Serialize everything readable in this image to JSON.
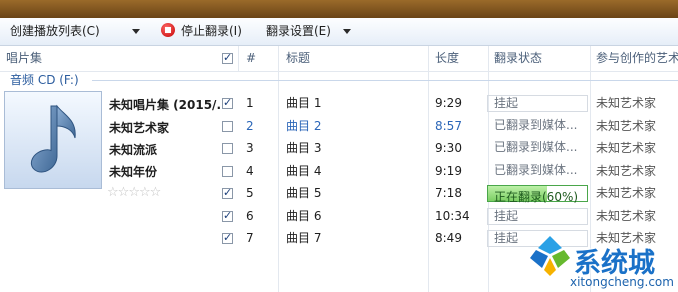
{
  "toolbar": {
    "create_playlist": "创建播放列表(C)",
    "stop_rip": "停止翻录(I)",
    "rip_settings": "翻录设置(E)"
  },
  "columns": {
    "album": "唱片集",
    "num": "#",
    "title": "标题",
    "length": "长度",
    "rip_status": "翻录状态",
    "artist": "参与创作的艺术"
  },
  "group": {
    "title": "音频 CD (F:)"
  },
  "album": {
    "name": "未知唱片集 (2015/...",
    "artist": "未知艺术家",
    "genre": "未知流派",
    "year": "未知年份",
    "rating_stars": 5
  },
  "tracks": [
    {
      "num": "1",
      "title": "曲目 1",
      "length": "9:29",
      "status": "挂起",
      "artist": "未知艺术家",
      "checked": true,
      "playing": false
    },
    {
      "num": "2",
      "title": "曲目 2",
      "length": "8:57",
      "status": "已翻录到媒体...",
      "artist": "未知艺术家",
      "checked": false,
      "playing": true
    },
    {
      "num": "3",
      "title": "曲目 3",
      "length": "9:30",
      "status": "已翻录到媒体...",
      "artist": "未知艺术家",
      "checked": false,
      "playing": false
    },
    {
      "num": "4",
      "title": "曲目 4",
      "length": "9:19",
      "status": "已翻录到媒体...",
      "artist": "未知艺术家",
      "checked": false,
      "playing": false
    },
    {
      "num": "5",
      "title": "曲目 5",
      "length": "7:18",
      "status": "正在翻录(60%)",
      "progress": 0.6,
      "artist": "未知艺术家",
      "checked": true,
      "playing": false
    },
    {
      "num": "6",
      "title": "曲目 6",
      "length": "10:34",
      "status": "挂起",
      "artist": "未知艺术家",
      "checked": true,
      "playing": false
    },
    {
      "num": "7",
      "title": "曲目 7",
      "length": "8:49",
      "status": "挂起",
      "artist": "未知艺术家",
      "checked": true,
      "playing": false
    }
  ],
  "watermark": {
    "name": "系统城",
    "url": "xitongcheng.com"
  },
  "colors": {
    "accent": "#2b66b8",
    "progress": "#7ccf64",
    "toolbar_bg": "#e6eef8"
  }
}
